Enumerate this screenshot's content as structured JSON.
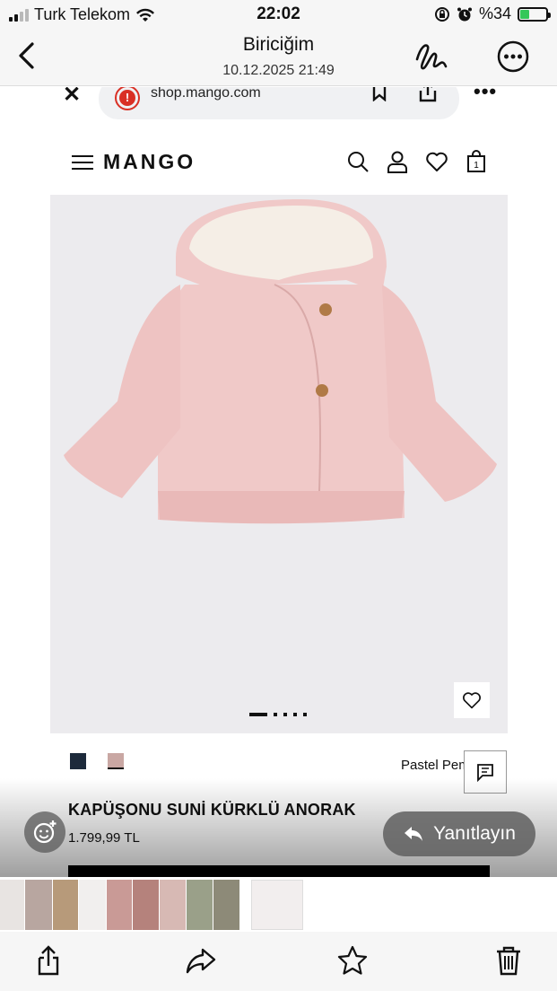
{
  "status_bar": {
    "carrier": "Turk Telekom",
    "time": "22:02",
    "battery": "%34",
    "battery_level": 0.34
  },
  "header": {
    "title": "Biriciğim",
    "subtitle": "10.12.2025 21:49"
  },
  "browser": {
    "url": "shop.mango.com"
  },
  "site": {
    "logo": "MANGO",
    "cart_count": "1"
  },
  "product": {
    "color_name": "Pastel Pem",
    "name": "KAPÜŞONU SUNİ KÜRKLÜ ANORAK",
    "price": "1.799,99 TL",
    "swatch_colors": [
      "#1d2a3b",
      "#c9a7a3"
    ]
  },
  "actions": {
    "reply_label": "Yanıtlayın"
  },
  "colors": {
    "coat": "#f0c9c8",
    "fur": "#f5eee6"
  }
}
